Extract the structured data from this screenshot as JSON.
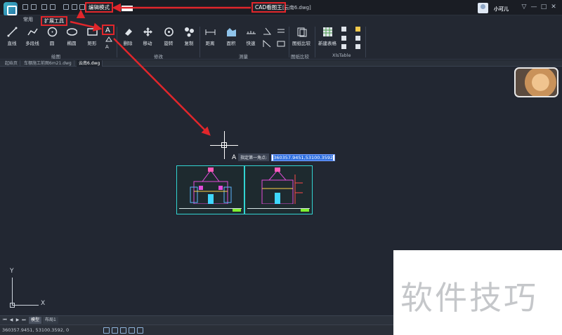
{
  "titlebar": {
    "mode_label": "编辑模式",
    "app_name": "CAD看图王",
    "filename": "[云南6.dwg]",
    "user_name": "小可儿",
    "window_buttons": [
      "▽",
      "—",
      "□",
      "✕"
    ]
  },
  "ribbon": {
    "tabs": [
      {
        "label": "常用"
      },
      {
        "label": "扩展工具"
      }
    ],
    "tools": {
      "line": "直线",
      "polyline": "多段线",
      "circle": "圆",
      "ellipse": "椭圆",
      "rect": "矩形",
      "delete": "删除",
      "move": "移动",
      "rotate": "旋转",
      "copy": "复制",
      "distance": "距离",
      "area": "面积",
      "quick": "快速",
      "compare": "图纸比较",
      "new_table": "新建表格"
    },
    "groups": {
      "draw": "绘图",
      "modify": "修改",
      "measure": "测量",
      "compare": "图纸比较",
      "xlstable": "XlsTable"
    }
  },
  "doc_tabs": [
    {
      "label": "起始页"
    },
    {
      "label": "车棚施工前图6m21.dwg"
    },
    {
      "label": "云南6.dwg"
    }
  ],
  "canvas": {
    "prompt_label": "指定第一角点:",
    "coord_value": "360357.9451,53100.3592",
    "ucs_x": "X",
    "ucs_y": "Y"
  },
  "layout_tabs": [
    {
      "label": "模型"
    },
    {
      "label": "布局1"
    }
  ],
  "status": {
    "coords": "360357.9451, 53100.3592, 0"
  },
  "watermark": "软件技巧",
  "colors": {
    "accent_red": "#e1262b",
    "background": "#222732",
    "cyan_frame": "#32d4d2"
  }
}
